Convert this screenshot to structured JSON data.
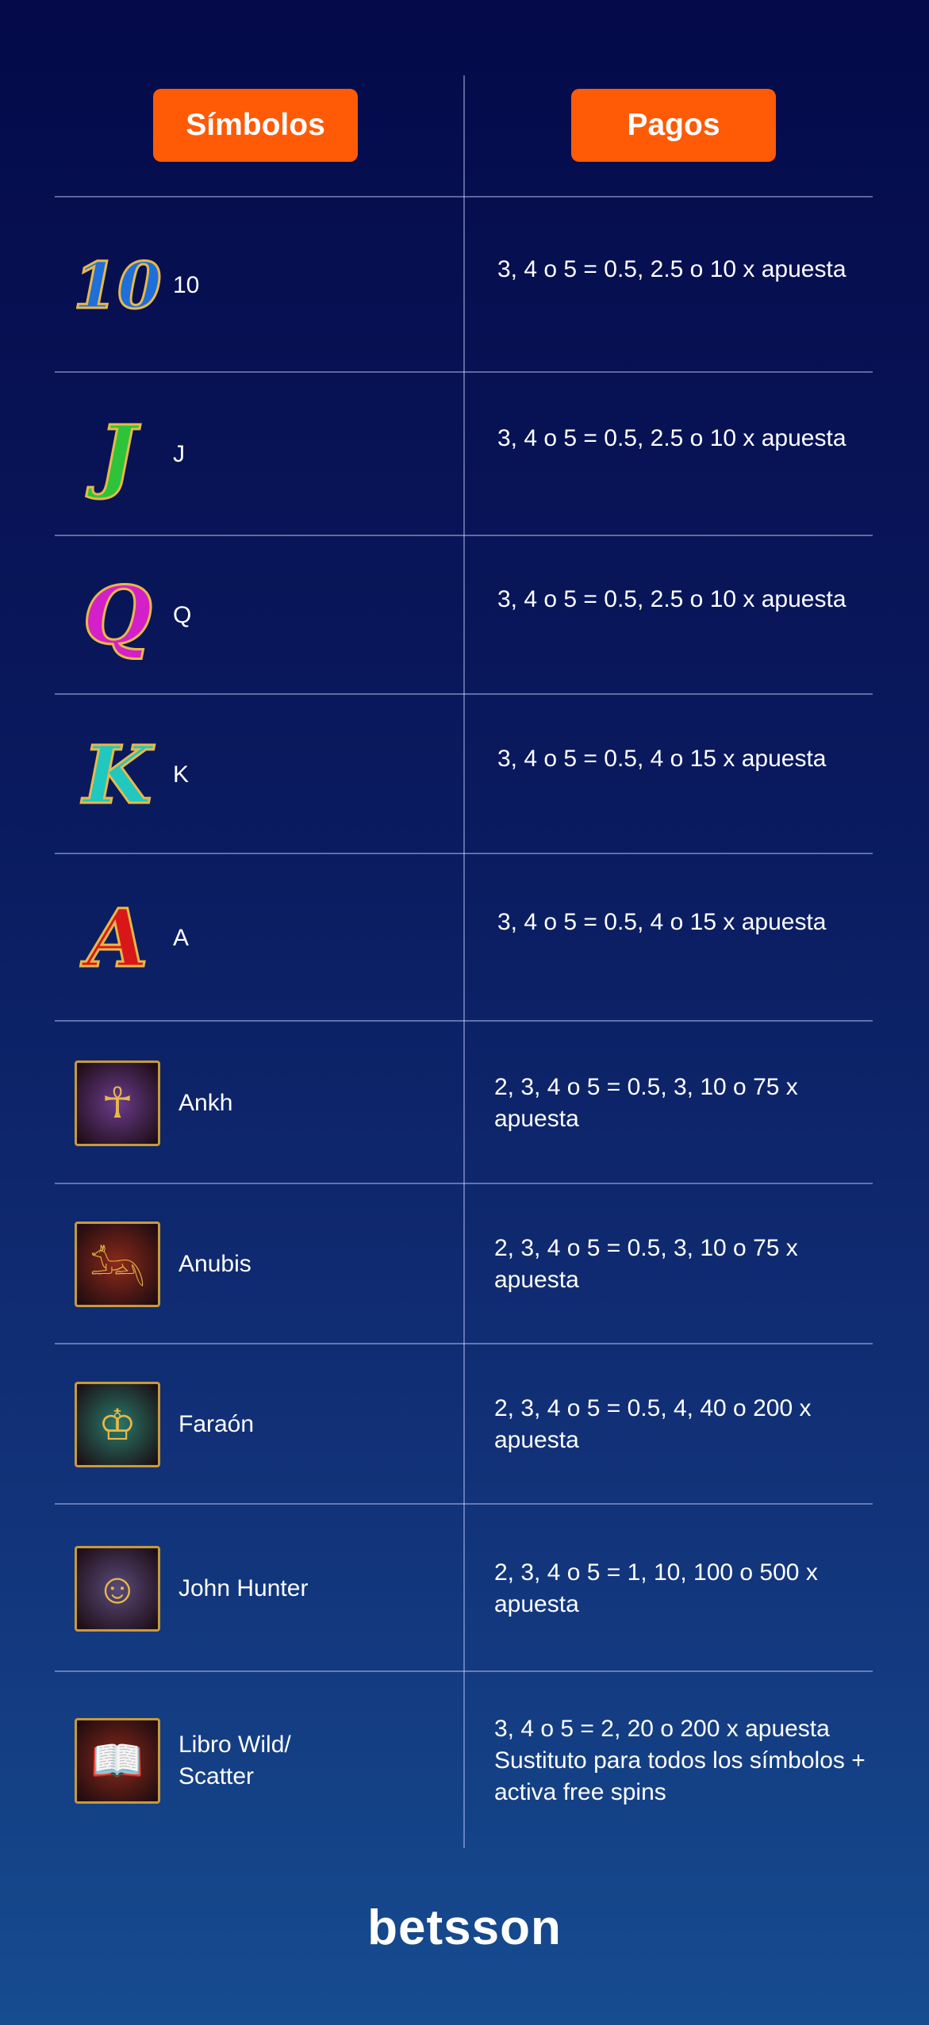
{
  "header": {
    "symbols_label": "Símbolos",
    "payouts_label": "Pagos"
  },
  "rows": [
    {
      "icon": "ten-icon",
      "icon_glyph": "10",
      "icon_color": "#1e6fd9",
      "name": "10",
      "payout": "3, 4 o 5 = 0.5, 2.5 o 10 x apuesta"
    },
    {
      "icon": "j-icon",
      "icon_glyph": "J",
      "icon_color": "#2ec43a",
      "name": "J",
      "payout": "3, 4 o 5 = 0.5, 2.5 o 10 x apuesta"
    },
    {
      "icon": "q-icon",
      "icon_glyph": "Q",
      "icon_color": "#d320c8",
      "name": "Q",
      "payout": "3, 4 o 5 = 0.5, 2.5 o 10 x apuesta"
    },
    {
      "icon": "k-icon",
      "icon_glyph": "K",
      "icon_color": "#20c8c0",
      "name": "K",
      "payout": "3, 4 o 5 = 0.5, 4 o 15 x apuesta"
    },
    {
      "icon": "a-icon",
      "icon_glyph": "A",
      "icon_color": "#d81818",
      "name": "A",
      "payout": "3, 4 o 5 = 0.5, 4 o 15 x apuesta"
    },
    {
      "icon": "ankh-icon",
      "icon_glyph": "☥",
      "icon_color": "#6a3c8c",
      "name": "Ankh",
      "payout": "2, 3, 4 o 5 = 0.5, 3, 10 o 75 x apuesta"
    },
    {
      "icon": "anubis-icon",
      "icon_glyph": "𓃢",
      "icon_color": "#8c2a1a",
      "name": "Anubis",
      "payout": "2, 3, 4 o 5 = 0.5, 3, 10 o 75 x apuesta"
    },
    {
      "icon": "pharaoh-icon",
      "icon_glyph": "♔",
      "icon_color": "#2a7a6a",
      "name": "Faraón",
      "payout": "2, 3, 4 o 5 = 0.5, 4, 40 o 200 x apuesta"
    },
    {
      "icon": "john-hunter-icon",
      "icon_glyph": "☺",
      "icon_color": "#5a4a7a",
      "name": "John Hunter",
      "payout": "2, 3, 4 o 5 = 1, 10, 100 o 500 x apuesta"
    },
    {
      "icon": "book-icon",
      "icon_glyph": "📖",
      "icon_color": "#8a2a1a",
      "name": "Libro Wild/\nScatter",
      "payout": "3, 4 o 5 = 2, 20 o 200 x apuesta Sustituto para todos los símbolos + activa free spins"
    }
  ],
  "footer": {
    "brand": "betsson"
  },
  "colors": {
    "accent": "#ff5a06",
    "background_top": "#040a4a",
    "background_bottom": "#164c90"
  }
}
